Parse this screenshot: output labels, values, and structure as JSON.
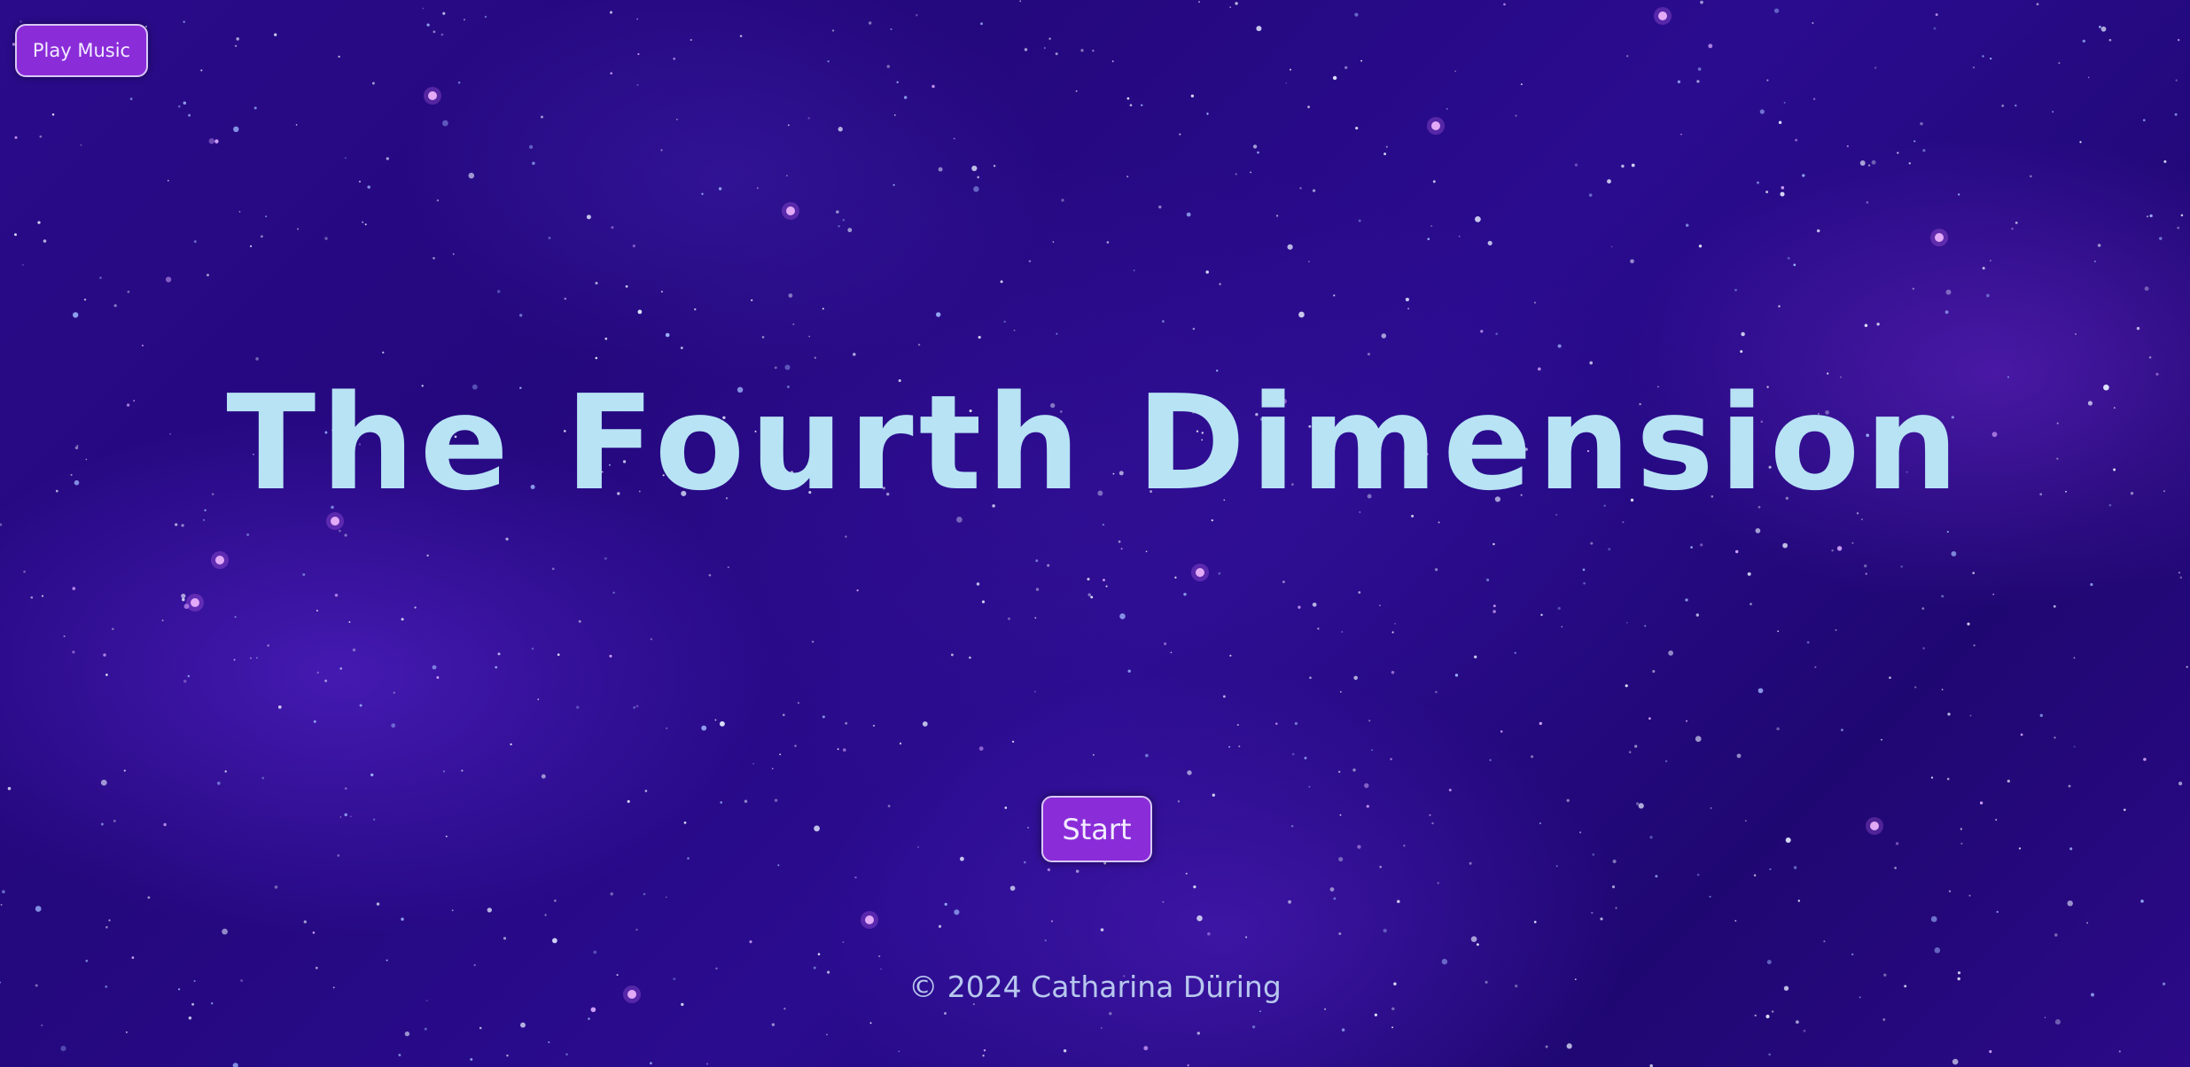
{
  "header": {
    "music_button_label": "Play Music"
  },
  "main": {
    "title": "The Fourth Dimension",
    "start_button_label": "Start"
  },
  "footer": {
    "copyright": "© 2024 Catharina Düring"
  },
  "colors": {
    "button_fill": "#8b2cd9",
    "button_border": "#d8c8f5",
    "title_text": "#b7e3f5",
    "background": "#2a0b8a"
  }
}
